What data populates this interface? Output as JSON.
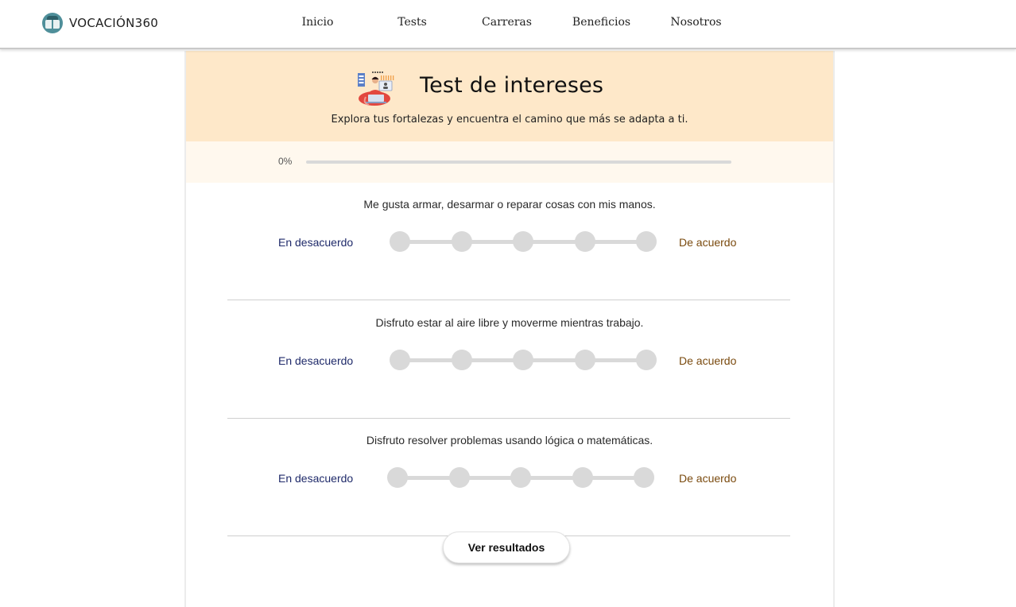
{
  "brand": {
    "name": "VOCACIÓN360",
    "logo_icon": "book-logo-icon"
  },
  "nav": [
    "Inicio",
    "Tests",
    "Carreras",
    "Beneficios",
    "Nosotros"
  ],
  "hero": {
    "title": "Test de intereses",
    "subtitle": "Explora tus fortalezas y encuentra el camino que más se adapta a ti.",
    "illustration_icon": "person-laptop-illustration"
  },
  "progress": {
    "label": "0%",
    "value": 0
  },
  "questions": [
    {
      "text": "Me gusta armar, desarmar o reparar cosas con mis manos.",
      "left_label": "En desacuerdo",
      "right_label": "De acuerdo",
      "options": 5,
      "selected": null
    },
    {
      "text": "Disfruto estar al aire libre y moverme mientras trabajo.",
      "left_label": "En desacuerdo",
      "right_label": "De acuerdo",
      "options": 5,
      "selected": null
    },
    {
      "text": "Disfruto resolver problemas usando lógica o matemáticas.",
      "left_label": "En desacuerdo",
      "right_label": "De acuerdo",
      "options": 5,
      "selected": null
    }
  ],
  "results_button": "Ver resultados",
  "colors": {
    "hero_bg": "#fee8c9",
    "progress_band_bg": "#fff8ee",
    "disagree_text": "#1f2a6a",
    "agree_text": "#7a4a0e",
    "scale_gray": "#d9d9d9"
  }
}
